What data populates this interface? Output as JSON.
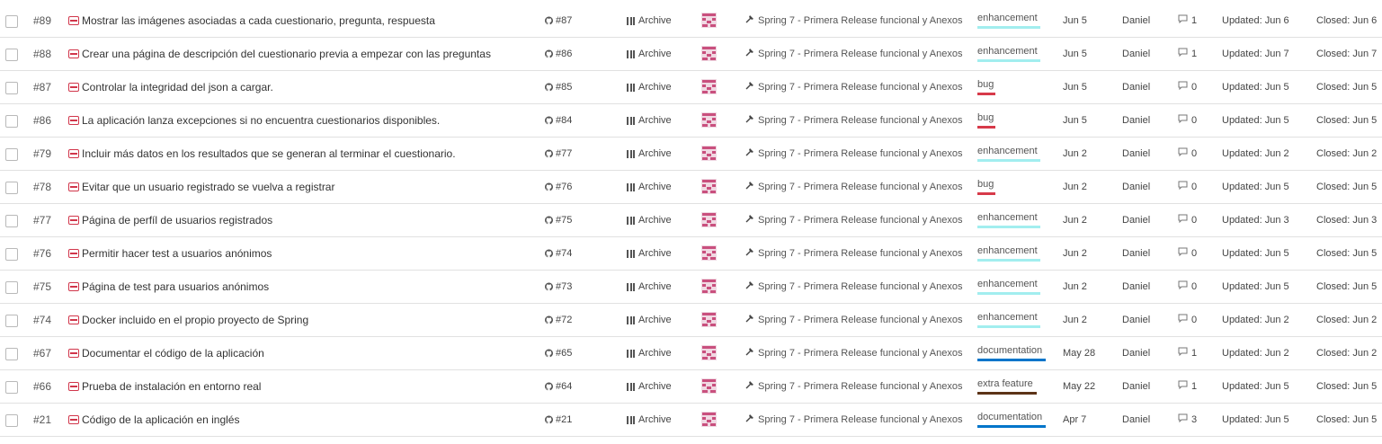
{
  "colors": {
    "issue_icon": "#d1364b",
    "enhancement": "#a2eeef",
    "bug": "#d73a4a",
    "documentation": "#0075ca",
    "extra_feature": "#5c3317"
  },
  "icons": {
    "row_checkbox": "checkbox-icon",
    "issue": "issue-icon",
    "github_pr": "github-icon",
    "column": "archive-column-icon",
    "assignee": "avatar-icon",
    "milestone": "milestone-icon",
    "comments": "comment-icon"
  },
  "rows": [
    {
      "num": "#89",
      "title": "Mostrar las imágenes asociadas a cada cuestionario, pregunta, respuesta",
      "pr": "#87",
      "column": "Archive",
      "milestone": "Spring 7 - Primera Release funcional y Anexos",
      "label": "enhancement",
      "label_color": "#a2eeef",
      "date": "Jun 5",
      "user": "Daniel",
      "comments": "1",
      "updated": "Updated: Jun 6",
      "closed": "Closed: Jun 6"
    },
    {
      "num": "#88",
      "title": "Crear una página de descripción del cuestionario previa a empezar con las preguntas",
      "pr": "#86",
      "column": "Archive",
      "milestone": "Spring 7 - Primera Release funcional y Anexos",
      "label": "enhancement",
      "label_color": "#a2eeef",
      "date": "Jun 5",
      "user": "Daniel",
      "comments": "1",
      "updated": "Updated: Jun 7",
      "closed": "Closed: Jun 7"
    },
    {
      "num": "#87",
      "title": "Controlar la integridad del json a cargar.",
      "pr": "#85",
      "column": "Archive",
      "milestone": "Spring 7 - Primera Release funcional y Anexos",
      "label": "bug",
      "label_color": "#d73a4a",
      "date": "Jun 5",
      "user": "Daniel",
      "comments": "0",
      "updated": "Updated: Jun 5",
      "closed": "Closed: Jun 5"
    },
    {
      "num": "#86",
      "title": "La aplicación lanza excepciones si no encuentra cuestionarios disponibles.",
      "pr": "#84",
      "column": "Archive",
      "milestone": "Spring 7 - Primera Release funcional y Anexos",
      "label": "bug",
      "label_color": "#d73a4a",
      "date": "Jun 5",
      "user": "Daniel",
      "comments": "0",
      "updated": "Updated: Jun 5",
      "closed": "Closed: Jun 5"
    },
    {
      "num": "#79",
      "title": "Incluir más datos en los resultados que se generan al terminar el cuestionario.",
      "pr": "#77",
      "column": "Archive",
      "milestone": "Spring 7 - Primera Release funcional y Anexos",
      "label": "enhancement",
      "label_color": "#a2eeef",
      "date": "Jun 2",
      "user": "Daniel",
      "comments": "0",
      "updated": "Updated: Jun 2",
      "closed": "Closed: Jun 2"
    },
    {
      "num": "#78",
      "title": "Evitar que un usuario registrado se vuelva a registrar",
      "pr": "#76",
      "column": "Archive",
      "milestone": "Spring 7 - Primera Release funcional y Anexos",
      "label": "bug",
      "label_color": "#d73a4a",
      "date": "Jun 2",
      "user": "Daniel",
      "comments": "0",
      "updated": "Updated: Jun 5",
      "closed": "Closed: Jun 5"
    },
    {
      "num": "#77",
      "title": "Página de perfíl de usuarios registrados",
      "pr": "#75",
      "column": "Archive",
      "milestone": "Spring 7 - Primera Release funcional y Anexos",
      "label": "enhancement",
      "label_color": "#a2eeef",
      "date": "Jun 2",
      "user": "Daniel",
      "comments": "0",
      "updated": "Updated: Jun 3",
      "closed": "Closed: Jun 3"
    },
    {
      "num": "#76",
      "title": "Permitir hacer test a usuarios anónimos",
      "pr": "#74",
      "column": "Archive",
      "milestone": "Spring 7 - Primera Release funcional y Anexos",
      "label": "enhancement",
      "label_color": "#a2eeef",
      "date": "Jun 2",
      "user": "Daniel",
      "comments": "0",
      "updated": "Updated: Jun 5",
      "closed": "Closed: Jun 5"
    },
    {
      "num": "#75",
      "title": "Página de test para usuarios anónimos",
      "pr": "#73",
      "column": "Archive",
      "milestone": "Spring 7 - Primera Release funcional y Anexos",
      "label": "enhancement",
      "label_color": "#a2eeef",
      "date": "Jun 2",
      "user": "Daniel",
      "comments": "0",
      "updated": "Updated: Jun 5",
      "closed": "Closed: Jun 5"
    },
    {
      "num": "#74",
      "title": "Docker incluido en el propio proyecto de Spring",
      "pr": "#72",
      "column": "Archive",
      "milestone": "Spring 7 - Primera Release funcional y Anexos",
      "label": "enhancement",
      "label_color": "#a2eeef",
      "date": "Jun 2",
      "user": "Daniel",
      "comments": "0",
      "updated": "Updated: Jun 2",
      "closed": "Closed: Jun 2"
    },
    {
      "num": "#67",
      "title": "Documentar el código de la aplicación",
      "pr": "#65",
      "column": "Archive",
      "milestone": "Spring 7 - Primera Release funcional y Anexos",
      "label": "documentation",
      "label_color": "#0075ca",
      "date": "May 28",
      "user": "Daniel",
      "comments": "1",
      "updated": "Updated: Jun 2",
      "closed": "Closed: Jun 2"
    },
    {
      "num": "#66",
      "title": "Prueba de instalación en entorno real",
      "pr": "#64",
      "column": "Archive",
      "milestone": "Spring 7 - Primera Release funcional y Anexos",
      "label": "extra feature",
      "label_color": "#5c3317",
      "date": "May 22",
      "user": "Daniel",
      "comments": "1",
      "updated": "Updated: Jun 5",
      "closed": "Closed: Jun 5"
    },
    {
      "num": "#21",
      "title": "Código de la aplicación en inglés",
      "pr": "#21",
      "column": "Archive",
      "milestone": "Spring 7 - Primera Release funcional y Anexos",
      "label": "documentation",
      "label_color": "#0075ca",
      "date": "Apr 7",
      "user": "Daniel",
      "comments": "3",
      "updated": "Updated: Jun 5",
      "closed": "Closed: Jun 5"
    }
  ]
}
